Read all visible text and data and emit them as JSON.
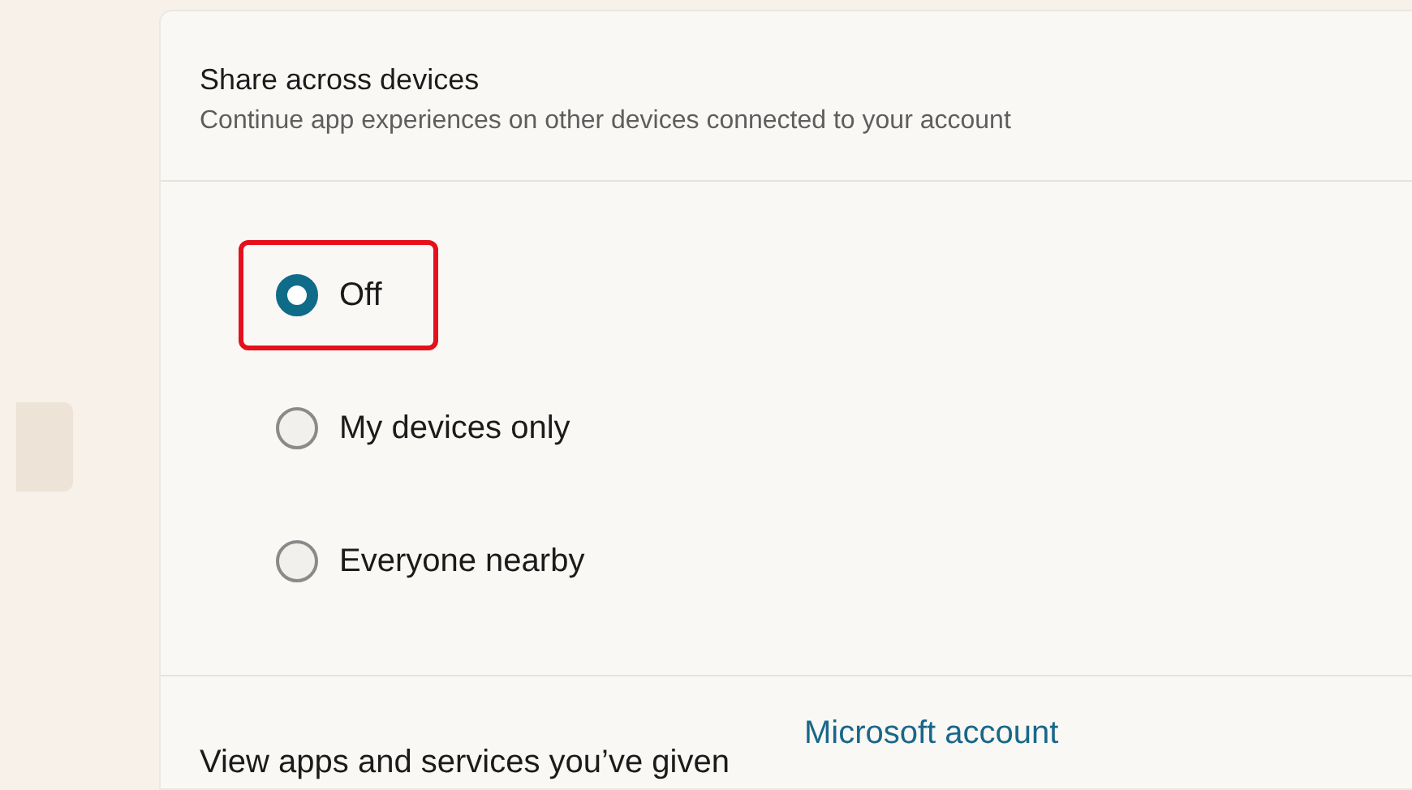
{
  "section": {
    "title": "Share across devices",
    "subtitle": "Continue app experiences on other devices connected to your account"
  },
  "options": [
    {
      "label": "Off",
      "selected": true,
      "highlighted": true
    },
    {
      "label": "My devices only",
      "selected": false,
      "highlighted": false
    },
    {
      "label": "Everyone nearby",
      "selected": false,
      "highlighted": false
    }
  ],
  "footer": {
    "text": "View apps and services you’ve given",
    "link": "Microsoft account"
  }
}
